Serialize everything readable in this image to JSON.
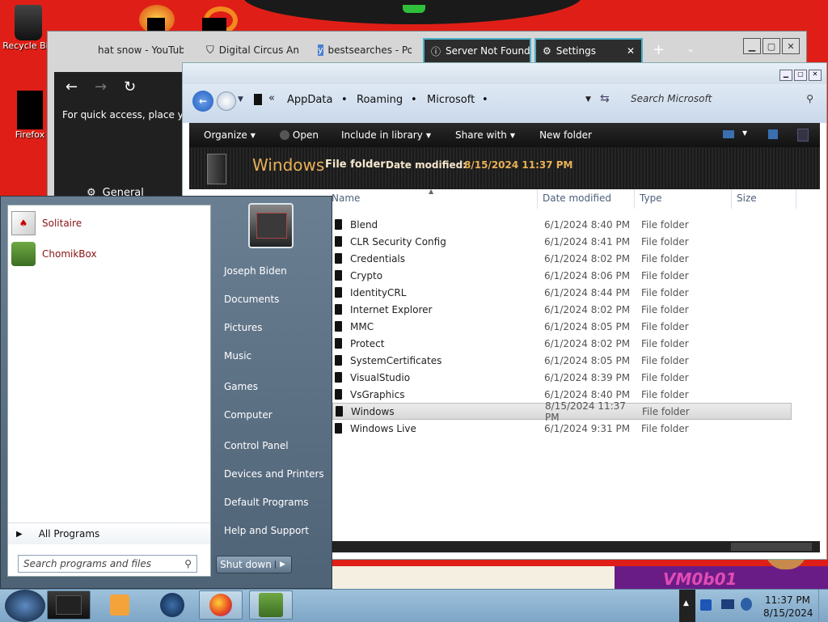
{
  "desktop": {
    "icons": [
      {
        "label": "Recycle Bin"
      },
      {
        "label": "Firefox"
      }
    ],
    "watermark": "VM0b01"
  },
  "browser": {
    "tabs": [
      {
        "label": "hat snow - YouTube"
      },
      {
        "label": "Digital Circus Ani"
      },
      {
        "label": "bestsearches - Po"
      },
      {
        "label": "Server Not Found"
      },
      {
        "label": "Settings"
      }
    ],
    "new_tab": "+",
    "quick_access_text": "For quick access, place your",
    "settings_label": "General"
  },
  "explorer": {
    "breadcrumb": [
      "AppData",
      "Roaming",
      "Microsoft"
    ],
    "search_placeholder": "Search Microsoft",
    "toolbar": {
      "organize": "Organize",
      "open": "Open",
      "include": "Include in library",
      "share": "Share with",
      "new_folder": "New folder"
    },
    "details": {
      "name": "Windows",
      "type": "File folder",
      "modified_label": "Date modified:",
      "modified": "8/15/2024 11:37 PM"
    },
    "columns": {
      "name": "Name",
      "date": "Date modified",
      "type": "Type",
      "size": "Size"
    },
    "rows": [
      {
        "name": "Blend",
        "date": "6/1/2024 8:40 PM",
        "type": "File folder"
      },
      {
        "name": "CLR Security Config",
        "date": "6/1/2024 8:41 PM",
        "type": "File folder"
      },
      {
        "name": "Credentials",
        "date": "6/1/2024 8:02 PM",
        "type": "File folder"
      },
      {
        "name": "Crypto",
        "date": "6/1/2024 8:06 PM",
        "type": "File folder"
      },
      {
        "name": "IdentityCRL",
        "date": "6/1/2024 8:44 PM",
        "type": "File folder"
      },
      {
        "name": "Internet Explorer",
        "date": "6/1/2024 8:02 PM",
        "type": "File folder"
      },
      {
        "name": "MMC",
        "date": "6/1/2024 8:05 PM",
        "type": "File folder"
      },
      {
        "name": "Protect",
        "date": "6/1/2024 8:02 PM",
        "type": "File folder"
      },
      {
        "name": "SystemCertificates",
        "date": "6/1/2024 8:05 PM",
        "type": "File folder"
      },
      {
        "name": "VisualStudio",
        "date": "6/1/2024 8:39 PM",
        "type": "File folder"
      },
      {
        "name": "VsGraphics",
        "date": "6/1/2024 8:40 PM",
        "type": "File folder"
      },
      {
        "name": "Windows",
        "date": "8/15/2024 11:37 PM",
        "type": "File folder"
      },
      {
        "name": "Windows Live",
        "date": "6/1/2024 9:31 PM",
        "type": "File folder"
      }
    ]
  },
  "start_menu": {
    "programs": [
      {
        "label": "Solitaire"
      },
      {
        "label": "ChomikBox"
      }
    ],
    "all_programs": "All Programs",
    "search_placeholder": "Search programs and files",
    "right_items": [
      {
        "label": "Joseph Biden"
      },
      {
        "label": "Documents"
      },
      {
        "label": "Pictures"
      },
      {
        "label": "Music"
      },
      {
        "label": "Games"
      },
      {
        "label": "Computer"
      },
      {
        "label": "Control Panel"
      },
      {
        "label": "Devices and Printers"
      },
      {
        "label": "Default Programs"
      },
      {
        "label": "Help and Support"
      }
    ],
    "shutdown": "Shut down"
  },
  "taskbar": {
    "time": "11:37 PM",
    "date": "8/15/2024"
  }
}
